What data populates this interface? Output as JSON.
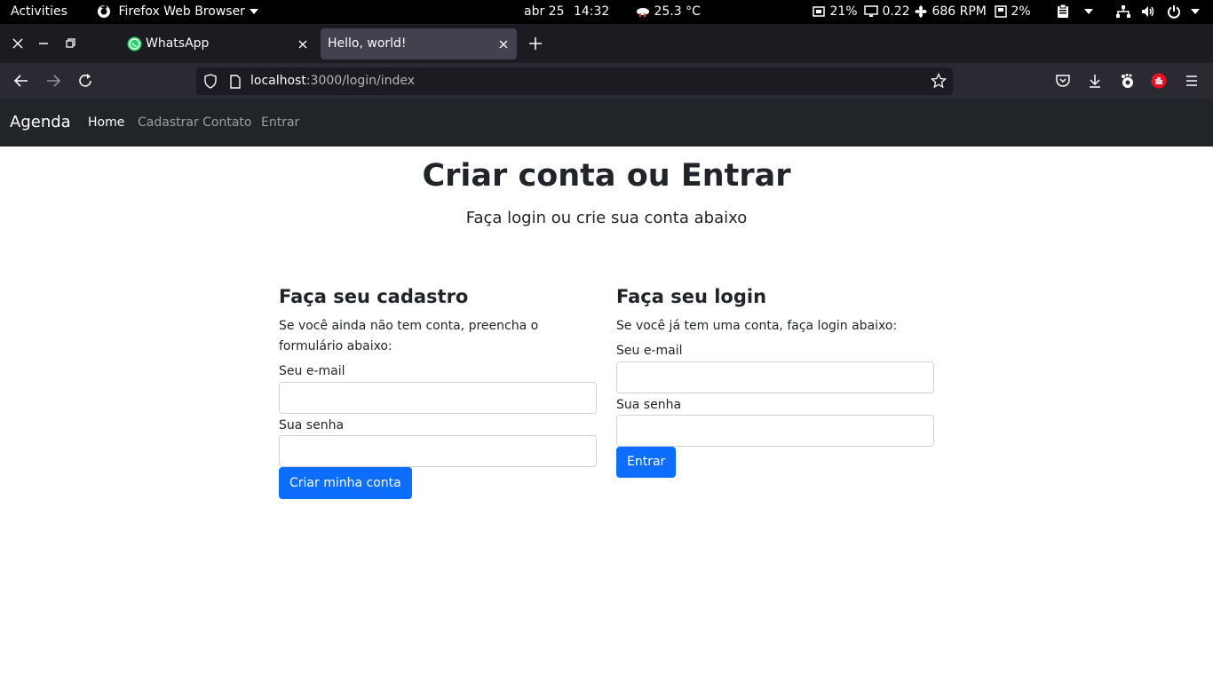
{
  "system_bar": {
    "activities": "Activities",
    "app_name": "Firefox Web Browser",
    "date": "abr 25",
    "time": "14:32",
    "temperature": "25.3 °C",
    "cpu": "21%",
    "load": "0.22",
    "fan": "686 RPM",
    "disk": "2%"
  },
  "browser": {
    "tabs": [
      {
        "label": "WhatsApp",
        "active": false
      },
      {
        "label": "Hello, world!",
        "active": true
      }
    ],
    "url": {
      "host": "localhost",
      "path": ":3000/login/index"
    }
  },
  "app_nav": {
    "brand": "Agenda",
    "links": [
      {
        "label": "Home",
        "active": true
      },
      {
        "label": "Cadastrar Contato",
        "active": false
      },
      {
        "label": "Entrar",
        "active": false
      }
    ]
  },
  "page": {
    "title": "Criar conta ou Entrar",
    "subtitle": "Faça login ou crie sua conta abaixo"
  },
  "register": {
    "title": "Faça seu cadastro",
    "description": "Se você ainda não tem conta, preencha o formulário abaixo:",
    "email_label": "Seu e-mail",
    "email_value": "",
    "password_label": "Sua senha",
    "password_value": "",
    "submit_label": "Criar minha conta"
  },
  "login": {
    "title": "Faça seu login",
    "description": "Se você já tem uma conta, faça login abaixo:",
    "email_label": "Seu e-mail",
    "email_value": "",
    "password_label": "Sua senha",
    "password_value": "",
    "submit_label": "Entrar"
  },
  "colors": {
    "primary": "#0d6efd",
    "navbar_bg": "#212529",
    "whatsapp_green": "#25d366"
  }
}
